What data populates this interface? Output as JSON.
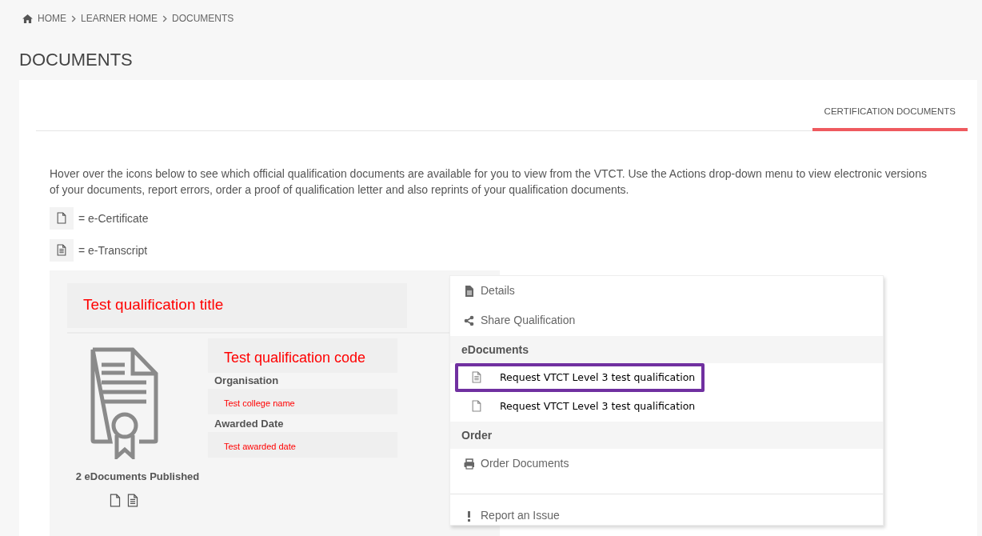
{
  "breadcrumb": [
    "HOME",
    "LEARNER HOME",
    "DOCUMENTS"
  ],
  "page_title": "DOCUMENTS",
  "tabs": [
    {
      "label": "CERTIFICATION DOCUMENTS",
      "selected": true
    }
  ],
  "intro": "Hover over the icons below to see which official qualification documents are available for you to view from the VTCT. Use the Actions drop-down menu to view electronic versions of your documents, report errors, order a proof of qualification letter and also reprints of your qualification documents.",
  "legend": [
    {
      "kind": "certificate",
      "label": "= e-Certificate"
    },
    {
      "kind": "transcript",
      "label": "= e-Transcript"
    }
  ],
  "qualification": {
    "title": "Test qualification title",
    "code": "Test qualification code",
    "fields": [
      {
        "label": "Organisation",
        "value": "Test college name"
      },
      {
        "label": "Awarded Date",
        "value": "Test awarded date"
      }
    ],
    "published": "2 eDocuments Published",
    "documents": [
      {
        "kind": "certificate"
      },
      {
        "kind": "transcript"
      }
    ]
  },
  "menu": [
    {
      "kind": "details",
      "label": "Details"
    },
    {
      "kind": "share",
      "label": "Share Qualification"
    },
    {
      "kind": "header",
      "label": "eDocuments"
    },
    {
      "kind": "transcript",
      "label": "Request VTCT Level 3 test qualification",
      "highlighted": true
    },
    {
      "kind": "certificate",
      "label": "Request VTCT Level 3 test qualification",
      "highlighted": false
    },
    {
      "kind": "header",
      "label": "Order"
    },
    {
      "kind": "print",
      "label": "Order Documents"
    },
    {
      "kind": "divider"
    },
    {
      "kind": "report",
      "label": "Report an Issue"
    }
  ]
}
